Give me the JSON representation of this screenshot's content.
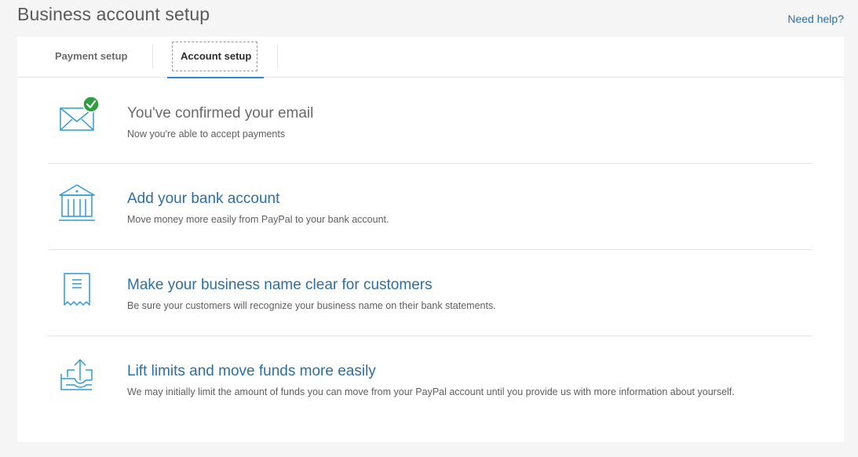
{
  "header": {
    "title": "Business account setup",
    "help_link": "Need help?"
  },
  "tabs": [
    {
      "label": "Payment setup",
      "active": false
    },
    {
      "label": "Account setup",
      "active": true
    }
  ],
  "tasks": [
    {
      "title": "You've confirmed your email",
      "description": "Now you're able to accept payments",
      "icon": "envelope-check-icon",
      "completed": true
    },
    {
      "title": "Add your bank account",
      "description": "Move money more easily from PayPal to your bank account.",
      "icon": "bank-icon",
      "completed": false
    },
    {
      "title": "Make your business name clear for customers",
      "description": "Be sure your customers will recognize your business name on their bank statements.",
      "icon": "receipt-icon",
      "completed": false
    },
    {
      "title": "Lift limits and move funds more easily",
      "description": "We may initially limit the amount of funds you can move from your PayPal account until you provide us with more information about yourself.",
      "icon": "upload-tray-icon",
      "completed": false
    }
  ],
  "colors": {
    "link": "#2c6fa5",
    "icon_stroke": "#2f9ad6",
    "success": "#2f9e3f",
    "tab_underline": "#2f86c8"
  }
}
